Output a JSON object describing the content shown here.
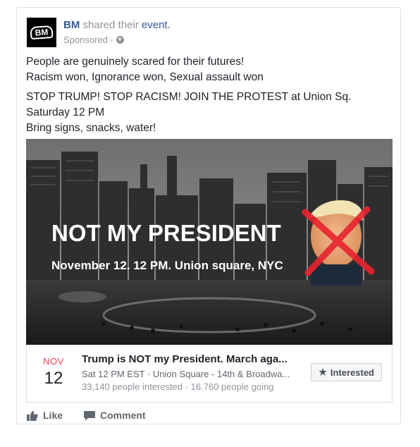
{
  "post": {
    "page_name": "BM",
    "avatar_text": "BM",
    "shared_text": "shared their",
    "event_link": "event.",
    "sponsored": "Sponsored ·",
    "body": {
      "p1_line1": "People are genuinely scared for their futures!",
      "p1_line2": "Racism won, Ignorance won, Sexual assault won",
      "p2_line1": "STOP TRUMP! STOP RACISM! JOIN THE PROTEST at Union Sq.",
      "p2_line2": "Saturday 12 PM",
      "p2_line3": "Bring signs, snacks, water!"
    }
  },
  "image": {
    "headline": "NOT MY PRESIDENT",
    "subline": "November 12. 12 PM. Union square, NYC"
  },
  "event": {
    "month": "NOV",
    "day": "12",
    "title": "Trump is NOT my President. March aga...",
    "details": "Sat 12 PM EST · Union Square - 14th & Broadwa...",
    "stats": "33,140 people interested · 16,760 people going",
    "interested_label": "Interested"
  },
  "actions": {
    "like": "Like",
    "comment": "Comment"
  },
  "colors": {
    "link_blue": "#365899",
    "month_red": "#f3425f",
    "muted": "#90949c",
    "cross_red": "#e8232f"
  },
  "icons": {
    "globe": "globe-icon",
    "star": "star-icon",
    "like": "thumbs-up-icon",
    "comment": "speech-bubble-icon"
  }
}
